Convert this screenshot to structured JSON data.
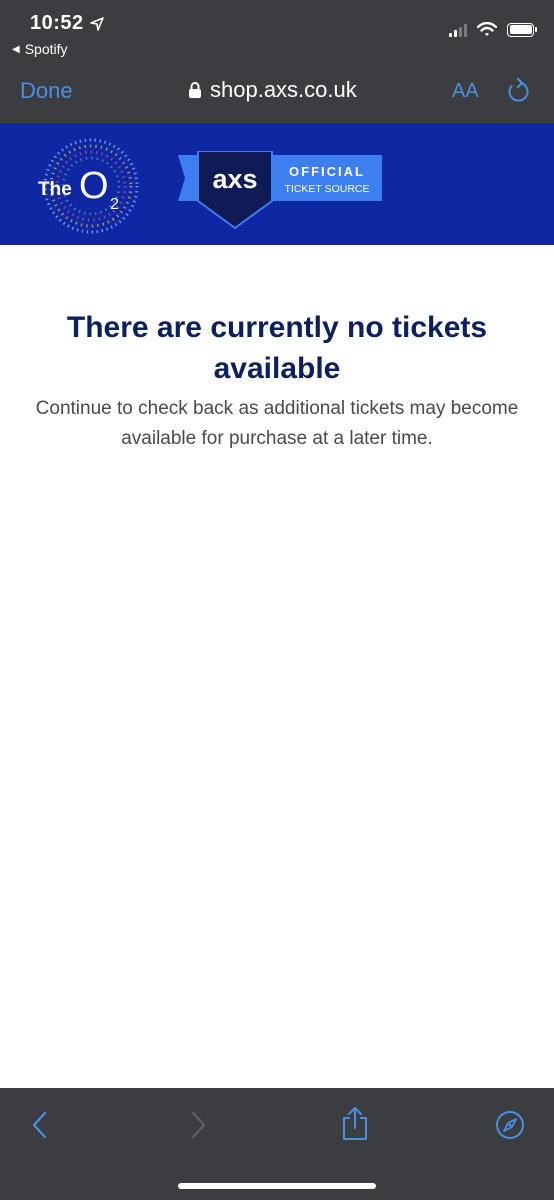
{
  "status_bar": {
    "time": "10:52",
    "back_app": "Spotify",
    "icons": [
      "location-icon",
      "cellular-signal-icon",
      "wifi-icon",
      "battery-icon"
    ]
  },
  "browser": {
    "done_label": "Done",
    "url": "shop.axs.co.uk",
    "text_size_label": "AA",
    "icons": [
      "lock-icon",
      "reload-icon"
    ]
  },
  "banner": {
    "background": "#0f27a3",
    "o2_logo": {
      "the": "The",
      "o": "O",
      "sub": "2"
    },
    "axs_logo": {
      "brand": "axs",
      "line1": "OFFICIAL",
      "line2": "TICKET SOURCE"
    }
  },
  "message": {
    "headline": "There are currently no tickets available",
    "body": "Continue to check back as additional tickets may become available for purchase at a later time."
  },
  "toolbar": {
    "icons": [
      "back-icon",
      "forward-icon",
      "share-icon",
      "safari-compass-icon"
    ]
  },
  "colors": {
    "chrome": "#3b3d40",
    "accent": "#4a90e2",
    "headline": "#0c1f5e"
  }
}
